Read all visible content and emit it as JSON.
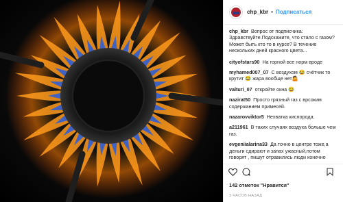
{
  "post": {
    "username": "chp_kbr",
    "separator": "•",
    "follow_label": "Подписаться",
    "caption_user": "chp_kbr",
    "caption_text": "Вопрос от подписчика: Здравствуйте.Подскажите, что стало с газом? Может быть кто то в курсе? В течение нескольких дней красного цвета..."
  },
  "comments": [
    {
      "user": "cityofstars90",
      "text": "На горной все норм вроде"
    },
    {
      "user": "myhamed007_07",
      "text": "С воздухом 😂 счётчик то крутит 😂 жара вообще нет🤷"
    },
    {
      "user": "valturi_07",
      "text": "откройте окна 😂"
    },
    {
      "user": "nazirat50",
      "text": "Просто грязный газ с врсоким содержанием примесей."
    },
    {
      "user": "nazarovviktor5",
      "text": "Нехватка кислорода."
    },
    {
      "user": "a211961",
      "text": "В таких случаях воздуха больше чем газ."
    },
    {
      "user": "evgeniialarina33",
      "text": "Да точно в центре тоже,а деньги сдирают и запах ужасный,потом говорят , пишут отравились люди конечно отправятся"
    }
  ],
  "likes_text": "142 отметок \"Нравится\"",
  "timestamp": "3 ЧАСОВ НАЗАД",
  "icons": {
    "like": "heart-icon",
    "comment": "speech-bubble-icon",
    "bookmark": "bookmark-icon",
    "avatar": "avatar-logo"
  },
  "colors": {
    "link_blue": "#3897f0",
    "flame_blue": "#2f5fd6",
    "flame_orange": "#ff9a1c",
    "border": "#efefef"
  }
}
